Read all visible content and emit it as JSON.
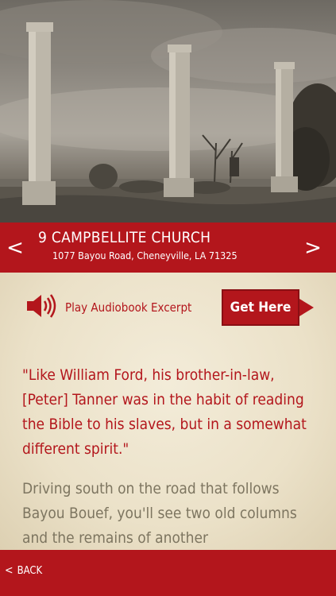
{
  "header": {
    "title": "9 CAMPBELLITE CHURCH",
    "address": "1077 Bayou Road, Cheneyville, LA 71325",
    "prev_arrow": "<",
    "next_arrow": ">"
  },
  "actions": {
    "audio_label": "Play Audiobook Excerpt",
    "get_label": "Get Here"
  },
  "content": {
    "quote": "\"Like William Ford, his brother-in-law, [Peter] Tanner was in the habit of reading the Bible to his slaves, but in a somewhat different spirit.\"",
    "body": "Driving south on the road that follows Bayou Bouef, you'll see two old columns and the remains of another"
  },
  "footer": {
    "back_chevron": "<",
    "back_label": "BACK"
  },
  "colors": {
    "accent": "#b3161c",
    "background": "#e9dfc7",
    "body_text": "#7d7560"
  },
  "icons": {
    "audio": "speaker-icon"
  }
}
